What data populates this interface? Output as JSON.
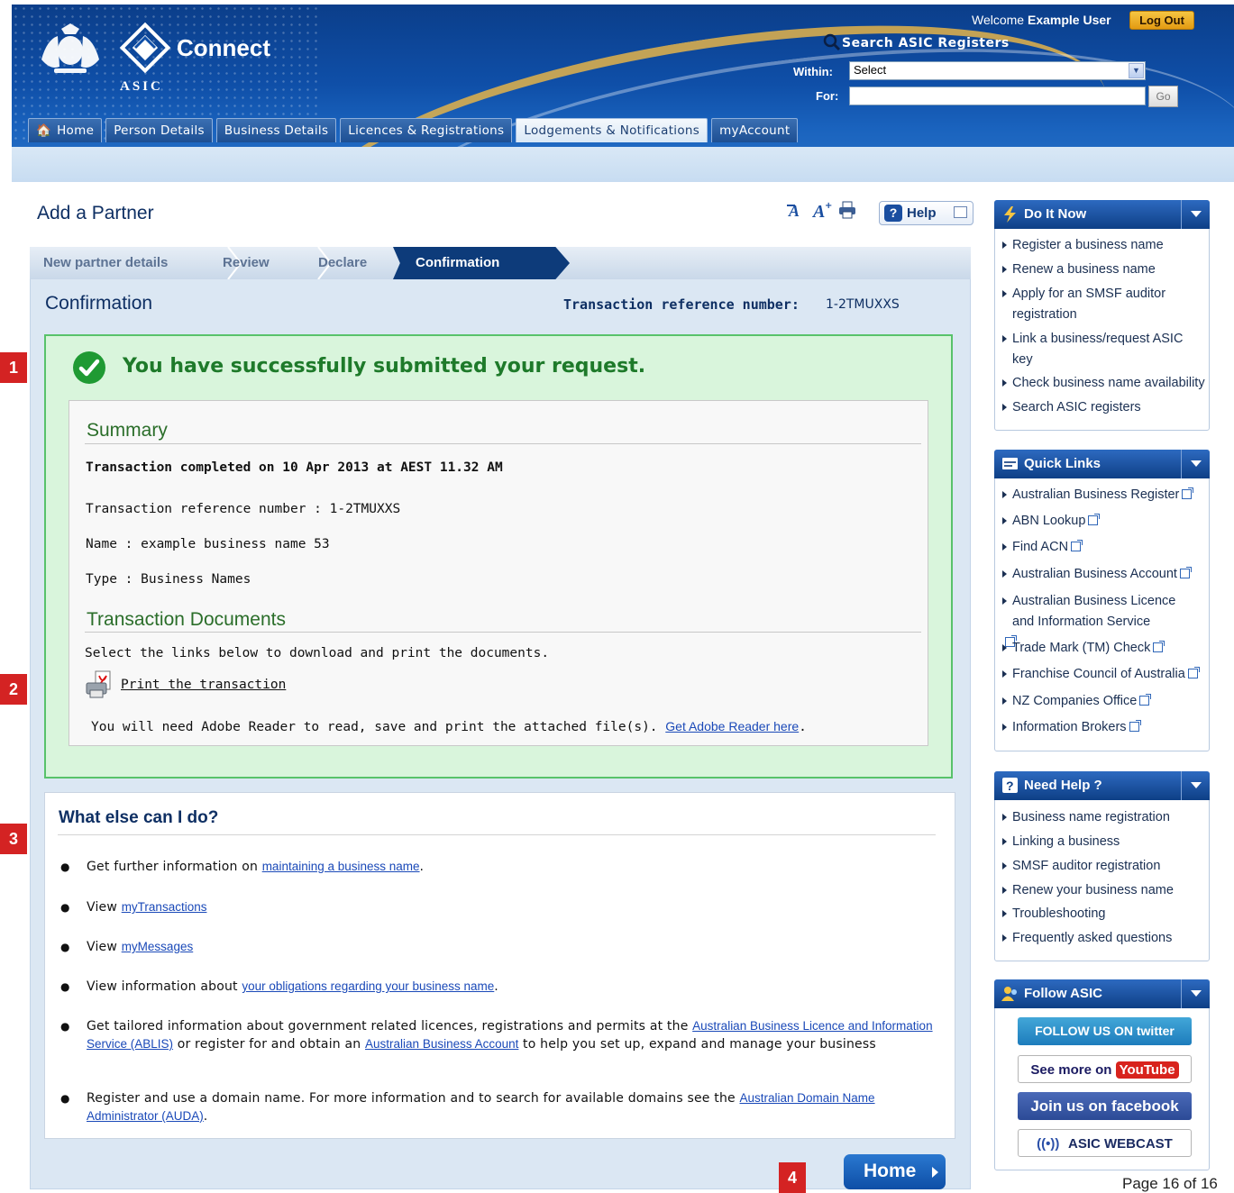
{
  "header": {
    "app_name": "Connect",
    "agency": "ASIC",
    "welcome_prefix": "Welcome",
    "user_name": "Example User",
    "logout_label": "Log Out",
    "search_title": "Search ASIC Registers",
    "within_label": "Within:",
    "within_value": "Select",
    "for_label": "For:",
    "for_value": "",
    "go_label": "Go",
    "tabs": [
      {
        "label": "Home",
        "active": false
      },
      {
        "label": "Person Details",
        "active": false
      },
      {
        "label": "Business Details",
        "active": false
      },
      {
        "label": "Licences & Registrations",
        "active": false
      },
      {
        "label": "Lodgements & Notifications",
        "active": true
      },
      {
        "label": "myAccount",
        "active": false
      }
    ]
  },
  "page": {
    "title": "Add a Partner",
    "help_label": "Help",
    "steps": [
      {
        "label": "New partner details",
        "active": false
      },
      {
        "label": "Review",
        "active": false
      },
      {
        "label": "Declare",
        "active": false
      },
      {
        "label": "Confirmation",
        "active": true
      }
    ],
    "confirmation_title": "Confirmation",
    "ref_label": "Transaction reference number:",
    "ref_value": "1-2TMUXXS",
    "success_message": "You have successfully submitted your request.",
    "summary": {
      "heading": "Summary",
      "completed": "Transaction completed on 10 Apr 2013 at AEST 11.32 AM",
      "ref_line": "Transaction reference number : 1-2TMUXXS",
      "name_line": "Name : example business name 53",
      "type_line": "Type : Business Names"
    },
    "documents": {
      "heading": "Transaction Documents",
      "instruction": "Select the links below to download and print the documents.",
      "print_link": "Print the transaction",
      "adobe_text": "You will need Adobe Reader to read, save and print the attached file(s).",
      "adobe_link": "Get Adobe Reader here",
      "adobe_end": "."
    },
    "what_else": {
      "heading": "What else can I do?",
      "b1_pre": "Get further information on",
      "b1_link": "maintaining a business name",
      "b1_post": ".",
      "b2_pre": "View",
      "b2_link": "myTransactions",
      "b3_pre": "View",
      "b3_link": "myMessages",
      "b4_pre": "View information about",
      "b4_link": "your obligations regarding your business name",
      "b4_post": ".",
      "b5_pre": "Get tailored information about government related licences, registrations and permits at the",
      "b5_link1": "Australian Business Licence and Information Service (ABLIS)",
      "b5_mid": "or register for and obtain an",
      "b5_link2": "Australian Business Account",
      "b5_post": "to help you set up, expand and manage your business",
      "b6_pre": "Register and use a domain name. For more information and to search for available domains see the",
      "b6_link": "Australian Domain Name Administrator (AUDA)",
      "b6_post": "."
    },
    "home_button": "Home"
  },
  "markers": [
    "1",
    "2",
    "3",
    "4"
  ],
  "sidebar": {
    "do_it_now": {
      "title": "Do It Now",
      "items": [
        "Register a business name",
        "Renew a business name",
        "Apply for an SMSF auditor registration",
        "Link a business/request ASIC key",
        "Check business name availability",
        "Search ASIC registers"
      ]
    },
    "quick_links": {
      "title": "Quick Links",
      "items": [
        "Australian Business Register",
        "ABN Lookup",
        "Find ACN",
        "Australian Business Account",
        "Australian Business Licence and Information Service",
        "Trade Mark (TM) Check",
        "Franchise Council of Australia",
        "NZ Companies Office",
        "Information Brokers"
      ]
    },
    "need_help": {
      "title": "Need Help ?",
      "items": [
        "Business name registration",
        "Linking a business",
        "SMSF auditor registration",
        "Renew your business name",
        "Troubleshooting",
        "Frequently asked questions"
      ]
    },
    "follow": {
      "title": "Follow ASIC",
      "twitter": "FOLLOW US ON twitter",
      "youtube_pre": "See more on",
      "youtube_brand": "YouTube",
      "facebook": "Join us on facebook",
      "webcast": "ASIC WEBCAST"
    }
  },
  "footer": {
    "page_number": "Page 16 of 16"
  },
  "colors": {
    "brand_blue": "#0e3f86",
    "success_green": "#58c26a",
    "marker_red": "#d42323",
    "logout_gold": "#e39b12"
  }
}
